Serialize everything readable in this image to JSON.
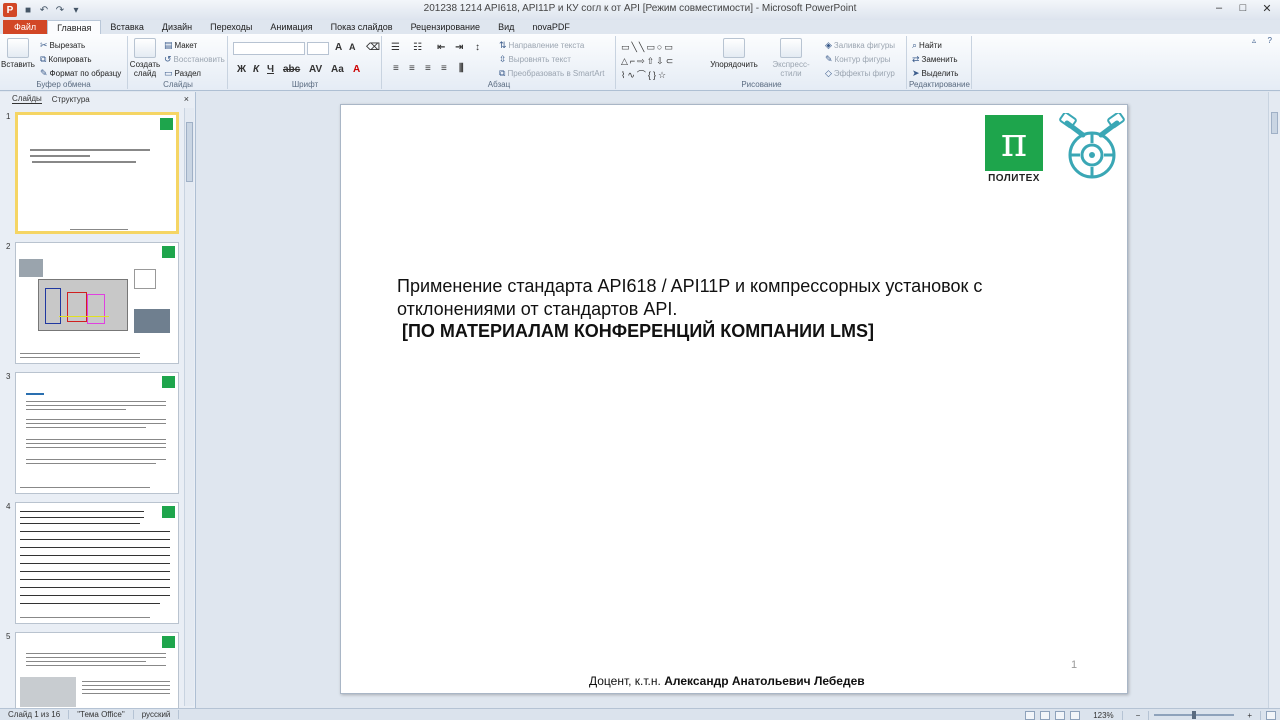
{
  "window": {
    "title": "201238 1214 API618, API11P и КУ согл к от API [Режим совместимости] - Microsoft PowerPoint",
    "app_icon": "P",
    "controls": [
      "–",
      "□",
      "✕"
    ]
  },
  "ribbon_tabs": [
    "Файл",
    "Главная",
    "Вставка",
    "Дизайн",
    "Переходы",
    "Анимация",
    "Показ слайдов",
    "Рецензирование",
    "Вид",
    "novaPDF"
  ],
  "ribbon": {
    "clipboard": {
      "label": "Буфер обмена",
      "paste": "Вставить",
      "cut": "Вырезать",
      "copy": "Копировать",
      "format_painter": "Формат по образцу"
    },
    "slides": {
      "label": "Слайды",
      "new_slide": "Создать слайд",
      "layout": "Макет",
      "reset": "Восстановить",
      "section": "Раздел"
    },
    "font": {
      "label": "Шрифт"
    },
    "paragraph": {
      "label": "Абзац",
      "text_direction": "Направление текста",
      "align_text": "Выровнять текст",
      "smartart": "Преобразовать в SmartArt"
    },
    "drawing": {
      "label": "Рисование",
      "arrange": "Упорядочить",
      "quick_styles": "Экспресс-стили",
      "fill": "Заливка фигуры",
      "outline": "Контур фигуры",
      "effects": "Эффекты фигур"
    },
    "editing": {
      "label": "Редактирование",
      "find": "Найти",
      "replace": "Заменить",
      "select": "Выделить"
    }
  },
  "panel": {
    "tab_slides": "Слайды",
    "tab_outline": "Структура",
    "close": "×",
    "slide_numbers": [
      "1",
      "2",
      "3",
      "4",
      "5"
    ]
  },
  "slide": {
    "logo_text": "ПОЛИТЕХ",
    "title": "Применение стандарта API618 / API11P и компрессорных установок с отклонениями от стандартов API.",
    "subtitle": "[ПО МАТЕРИАЛАМ КОНФЕРЕНЦИЙ КОМПАНИИ LMS]",
    "page_number": "1",
    "author_prefix": "Доцент, к.т.н.",
    "author_name": "Александр Анатольевич Лебедев"
  },
  "status": {
    "slide_info": "Слайд 1 из 16",
    "theme": "\"Тема Office\"",
    "language": "русский",
    "zoom": "123%"
  },
  "colors": {
    "file_tab": "#d24726",
    "logo_green": "#1ea54c",
    "logo_teal": "#3aa7b5",
    "thumb_selected": "#f5d564"
  }
}
